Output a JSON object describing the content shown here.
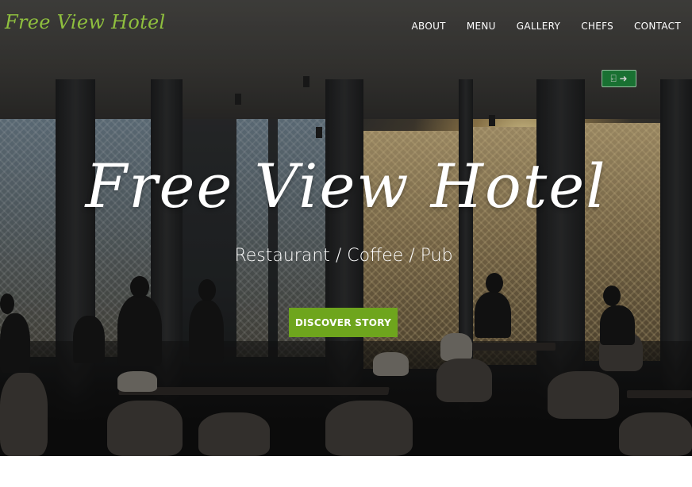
{
  "header": {
    "logo_text": "Free View Hotel",
    "nav": [
      {
        "label": "ABOUT"
      },
      {
        "label": "MENU"
      },
      {
        "label": "GALLERY"
      },
      {
        "label": "CHEFS"
      },
      {
        "label": "CONTACT"
      }
    ]
  },
  "hero": {
    "title": "Free View Hotel",
    "subtitle": "Restaurant / Coffee / Pub",
    "cta_label": "DISCOVER STORY",
    "exit_sign": "⍇ ➜"
  },
  "colors": {
    "accent": "#6ea51d",
    "logo": "#8fbf3e",
    "text": "#ffffff"
  }
}
